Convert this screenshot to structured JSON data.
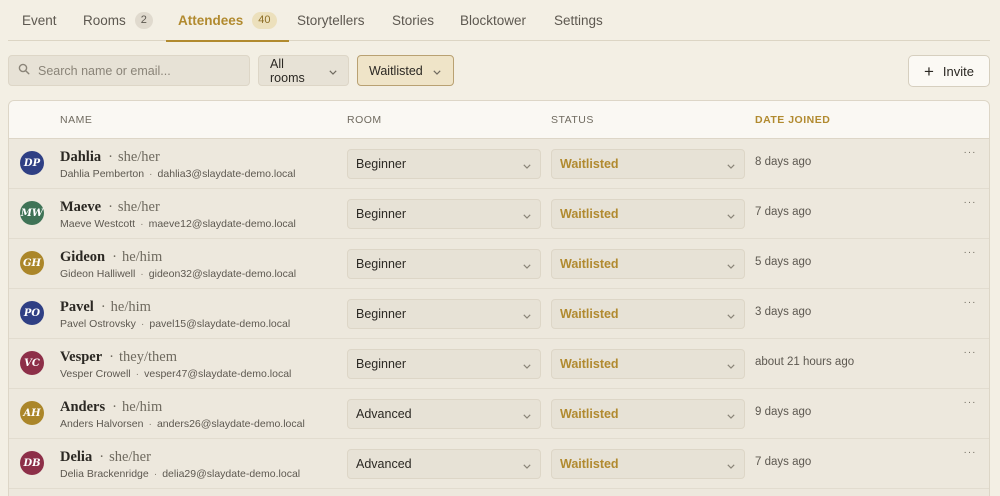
{
  "tabs": [
    {
      "label": "Event",
      "badge": null
    },
    {
      "label": "Rooms",
      "badge": "2"
    },
    {
      "label": "Attendees",
      "badge": "40"
    },
    {
      "label": "Storytellers",
      "badge": null
    },
    {
      "label": "Stories",
      "badge": null
    },
    {
      "label": "Blocktower",
      "badge": null
    },
    {
      "label": "Settings",
      "badge": null
    }
  ],
  "active_tab": "Attendees",
  "toolbar": {
    "search_placeholder": "Search name or email...",
    "room_filter": "All rooms",
    "status_filter": "Waitlisted",
    "invite_label": "Invite"
  },
  "table": {
    "columns": [
      "NAME",
      "ROOM",
      "STATUS",
      "DATE JOINED"
    ],
    "sorted_column": "DATE JOINED",
    "rows": [
      {
        "initials": "DP",
        "avatar_color": "#2f3f84",
        "first": "Dahlia",
        "pronouns": "she/her",
        "full_name": "Dahlia Pemberton",
        "email": "dahlia3@slaydate-demo.local",
        "room": "Beginner",
        "status": "Waitlisted",
        "joined": "8 days ago"
      },
      {
        "initials": "MW",
        "avatar_color": "#3f7356",
        "first": "Maeve",
        "pronouns": "she/her",
        "full_name": "Maeve Westcott",
        "email": "maeve12@slaydate-demo.local",
        "room": "Beginner",
        "status": "Waitlisted",
        "joined": "7 days ago"
      },
      {
        "initials": "GH",
        "avatar_color": "#ab8629",
        "first": "Gideon",
        "pronouns": "he/him",
        "full_name": "Gideon Halliwell",
        "email": "gideon32@slaydate-demo.local",
        "room": "Beginner",
        "status": "Waitlisted",
        "joined": "5 days ago"
      },
      {
        "initials": "PO",
        "avatar_color": "#2f3f84",
        "first": "Pavel",
        "pronouns": "he/him",
        "full_name": "Pavel Ostrovsky",
        "email": "pavel15@slaydate-demo.local",
        "room": "Beginner",
        "status": "Waitlisted",
        "joined": "3 days ago"
      },
      {
        "initials": "VC",
        "avatar_color": "#8d2f48",
        "first": "Vesper",
        "pronouns": "they/them",
        "full_name": "Vesper Crowell",
        "email": "vesper47@slaydate-demo.local",
        "room": "Beginner",
        "status": "Waitlisted",
        "joined": "about 21 hours ago"
      },
      {
        "initials": "AH",
        "avatar_color": "#ab8629",
        "first": "Anders",
        "pronouns": "he/him",
        "full_name": "Anders Halvorsen",
        "email": "anders26@slaydate-demo.local",
        "room": "Advanced",
        "status": "Waitlisted",
        "joined": "9 days ago"
      },
      {
        "initials": "DB",
        "avatar_color": "#8d2f48",
        "first": "Delia",
        "pronouns": "she/her",
        "full_name": "Delia Brackenridge",
        "email": "delia29@slaydate-demo.local",
        "room": "Advanced",
        "status": "Waitlisted",
        "joined": "7 days ago"
      }
    ]
  },
  "colors": {
    "accent": "#b18a2f",
    "background": "#f3efe4",
    "row_background": "#ede8dd"
  }
}
